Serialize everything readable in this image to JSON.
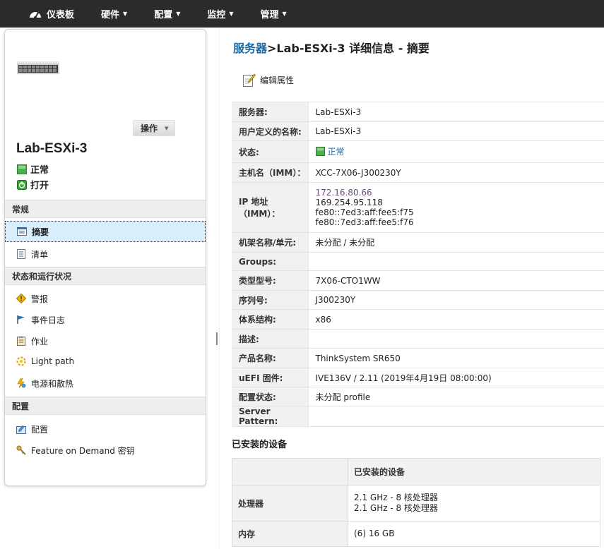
{
  "nav": {
    "dashboard": "仪表板",
    "hardware": "硬件",
    "config": "配置",
    "monitor": "监控",
    "manage": "管理",
    "caret": "▼"
  },
  "left": {
    "action_label": "操作",
    "server_name": "Lab-ESXi-3",
    "status_health": "正常",
    "status_power": "打开",
    "sections": {
      "general": "常规",
      "status": "状态和运行状况",
      "config": "配置"
    },
    "items": {
      "summary": "摘要",
      "inventory": "清单",
      "alerts": "警报",
      "event_log": "事件日志",
      "jobs": "作业",
      "light_path": "Light path",
      "power_cooling": "电源和散热",
      "configuration": "配置",
      "fod_keys": "Feature on Demand 密钥"
    }
  },
  "main": {
    "breadcrumb": "服务器",
    "title": ">Lab-ESXi-3 详细信息 - 摘要",
    "edit_label": "编辑属性",
    "props": {
      "server_k": "服务器:",
      "server_v": "Lab-ESXi-3",
      "userdef_k": "用户定义的名称:",
      "userdef_v": "Lab-ESXi-3",
      "state_k": "状态:",
      "state_v": "正常",
      "host_k": "主机名（IMM）：",
      "host_v": "XCC-7X06-J300230Y",
      "ip_k": "IP 地址（IMM）：",
      "ip1": "172.16.80.66",
      "ip2": "169.254.95.118",
      "ip3": "fe80::7ed3:aff:fee5:f75",
      "ip4": "fe80::7ed3:aff:fee5:f76",
      "rack_k": "机架名称/单元:",
      "rack_v": "未分配 / 未分配",
      "groups_k": "Groups:",
      "groups_v": "",
      "model_k": "类型型号:",
      "model_v": "7X06-CTO1WW",
      "serial_k": "序列号:",
      "serial_v": "J300230Y",
      "arch_k": "体系结构:",
      "arch_v": "x86",
      "desc_k": "描述:",
      "desc_v": "",
      "product_k": "产品名称:",
      "product_v": "ThinkSystem SR650",
      "uefi_k": "uEFI 固件:",
      "uefi_v": "IVE136V / 2.11 (2019年4月19日 08:00:00)",
      "cfgstate_k": "配置状态:",
      "cfgstate_v": "未分配 profile",
      "pattern_k": "Server Pattern:",
      "pattern_v": ""
    },
    "devices_title": "已安装的设备",
    "devices": {
      "header": "已安装的设备",
      "cpu_k": "处理器",
      "cpu_v1": "2.1 GHz - 8 核处理器",
      "cpu_v2": "2.1 GHz - 8 核处理器",
      "mem_k": "内存",
      "mem_v": "(6) 16 GB"
    }
  },
  "colors": {
    "topbar": "#2b2b2b",
    "link": "#1a6aa8",
    "ok_green": "#3aa33a",
    "active_bg": "#d9eefa"
  }
}
